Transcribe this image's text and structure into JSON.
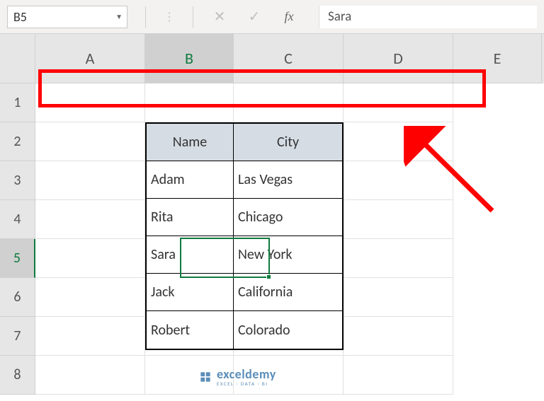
{
  "formula_bar": {
    "name_box": "B5",
    "formula_value": "Sara"
  },
  "columns": [
    "A",
    "B",
    "C",
    "D",
    "E"
  ],
  "rows": [
    "1",
    "2",
    "3",
    "4",
    "5",
    "6",
    "7",
    "8"
  ],
  "active_cell": "B5",
  "table": {
    "headers": [
      "Name",
      "City"
    ],
    "data": [
      {
        "name": "Adam",
        "city": "Las Vegas"
      },
      {
        "name": "Rita",
        "city": "Chicago"
      },
      {
        "name": "Sara",
        "city": "New York"
      },
      {
        "name": "Jack",
        "city": "California"
      },
      {
        "name": "Robert",
        "city": "Colorado"
      }
    ]
  },
  "watermark": {
    "text": "exceldemy",
    "sub": "EXCEL · DATA · BI"
  }
}
